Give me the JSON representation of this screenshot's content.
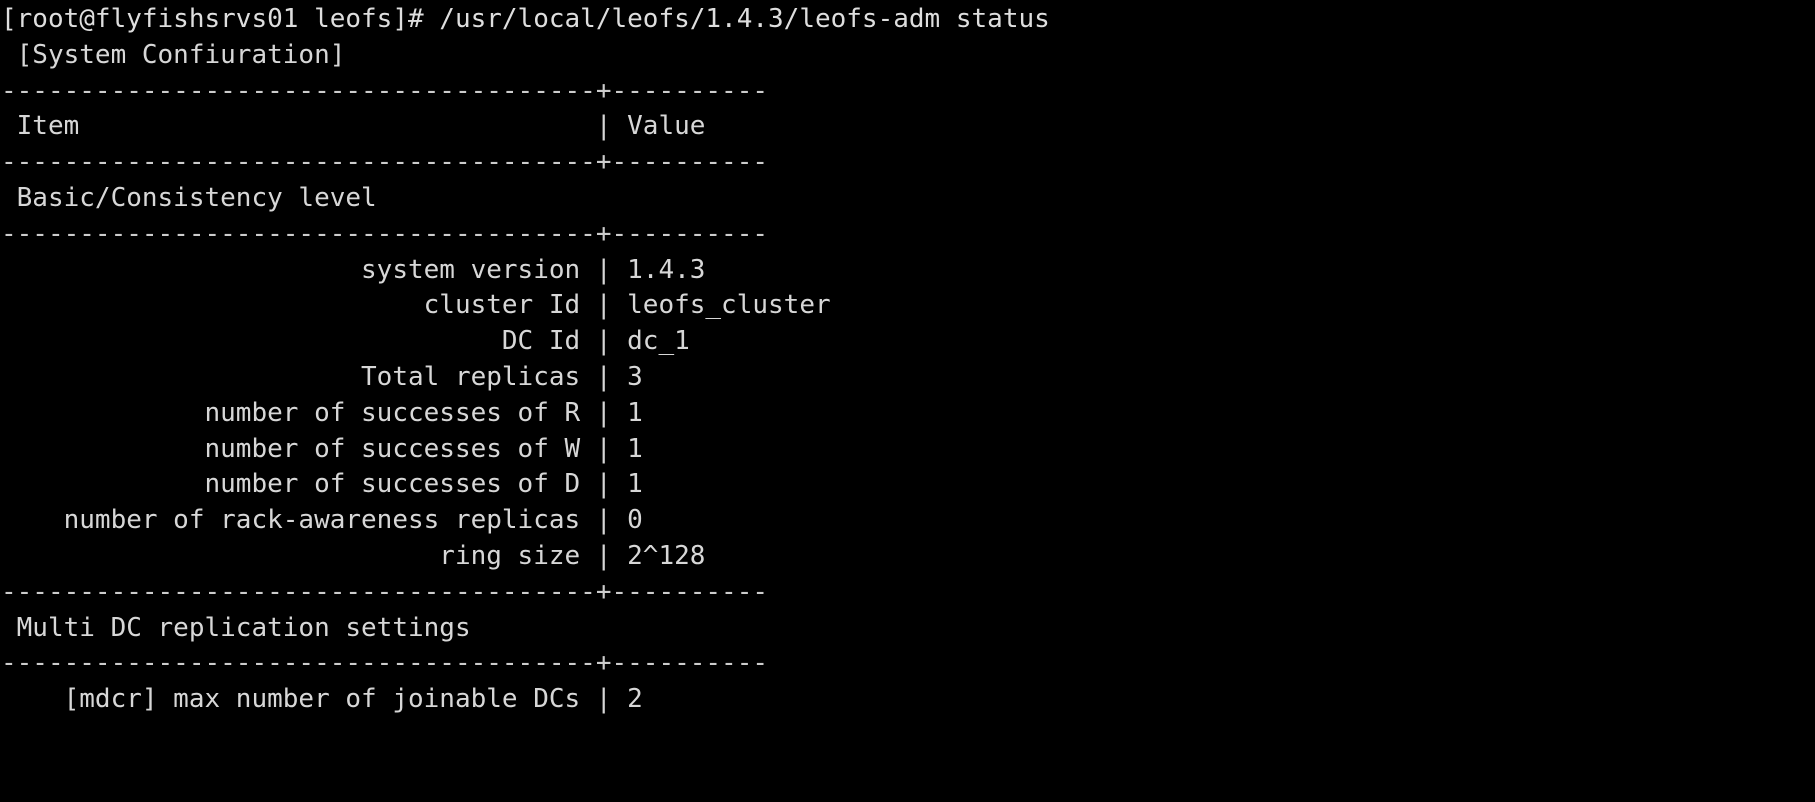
{
  "terminal": {
    "title": "leofs-adm status",
    "background_color": "#000000",
    "foreground_color": "#d7d7d7",
    "font_size_px": 26,
    "columns": 136,
    "rows": 22,
    "prompt": {
      "user": "root",
      "host": "flyfishsrvs01",
      "cwd": "leofs",
      "symbol": "#",
      "full": "[root@flyfishsrvs01 leofs]#"
    },
    "command": "/usr/local/leofs/1.4.3/leofs-adm status",
    "command_line": "[root@flyfishsrvs01 leofs]# /usr/local/leofs/1.4.3/leofs-adm status",
    "section_title": " [System Confiuration]",
    "separator": "--------------------------------------+----------",
    "header": {
      "item": " Item",
      "value": "Value",
      "line": " Item                                 | Value"
    },
    "groups": [
      {
        "name": "Basic/Consistency level",
        "label_line": " Basic/Consistency level",
        "rows": [
          {
            "item": "system version",
            "value": "1.4.3"
          },
          {
            "item": "cluster Id",
            "value": "leofs_cluster"
          },
          {
            "item": "DC Id",
            "value": "dc_1"
          },
          {
            "item": "Total replicas",
            "value": "3"
          },
          {
            "item": "number of successes of R",
            "value": "1"
          },
          {
            "item": "number of successes of W",
            "value": "1"
          },
          {
            "item": "number of successes of D",
            "value": "1"
          },
          {
            "item": "number of rack-awareness replicas",
            "value": "0"
          },
          {
            "item": "ring size",
            "value": "2^128"
          }
        ]
      },
      {
        "name": "Multi DC replication settings",
        "label_line": " Multi DC replication settings",
        "rows": [
          {
            "item": "[mdcr] max number of joinable DCs",
            "value": "2"
          }
        ]
      }
    ],
    "lines": [
      "[root@flyfishsrvs01 leofs]# /usr/local/leofs/1.4.3/leofs-adm status",
      " [System Confiuration]",
      "--------------------------------------+----------",
      " Item                                 | Value",
      "--------------------------------------+----------",
      " Basic/Consistency level",
      "--------------------------------------+----------",
      "                       system version | 1.4.3",
      "                           cluster Id | leofs_cluster",
      "                                DC Id | dc_1",
      "                       Total replicas | 3",
      "             number of successes of R | 1",
      "             number of successes of W | 1",
      "             number of successes of D | 1",
      "    number of rack-awareness replicas | 0",
      "                            ring size | 2^128",
      "--------------------------------------+----------",
      " Multi DC replication settings",
      "--------------------------------------+----------",
      "    [mdcr] max number of joinable DCs | 2"
    ]
  }
}
